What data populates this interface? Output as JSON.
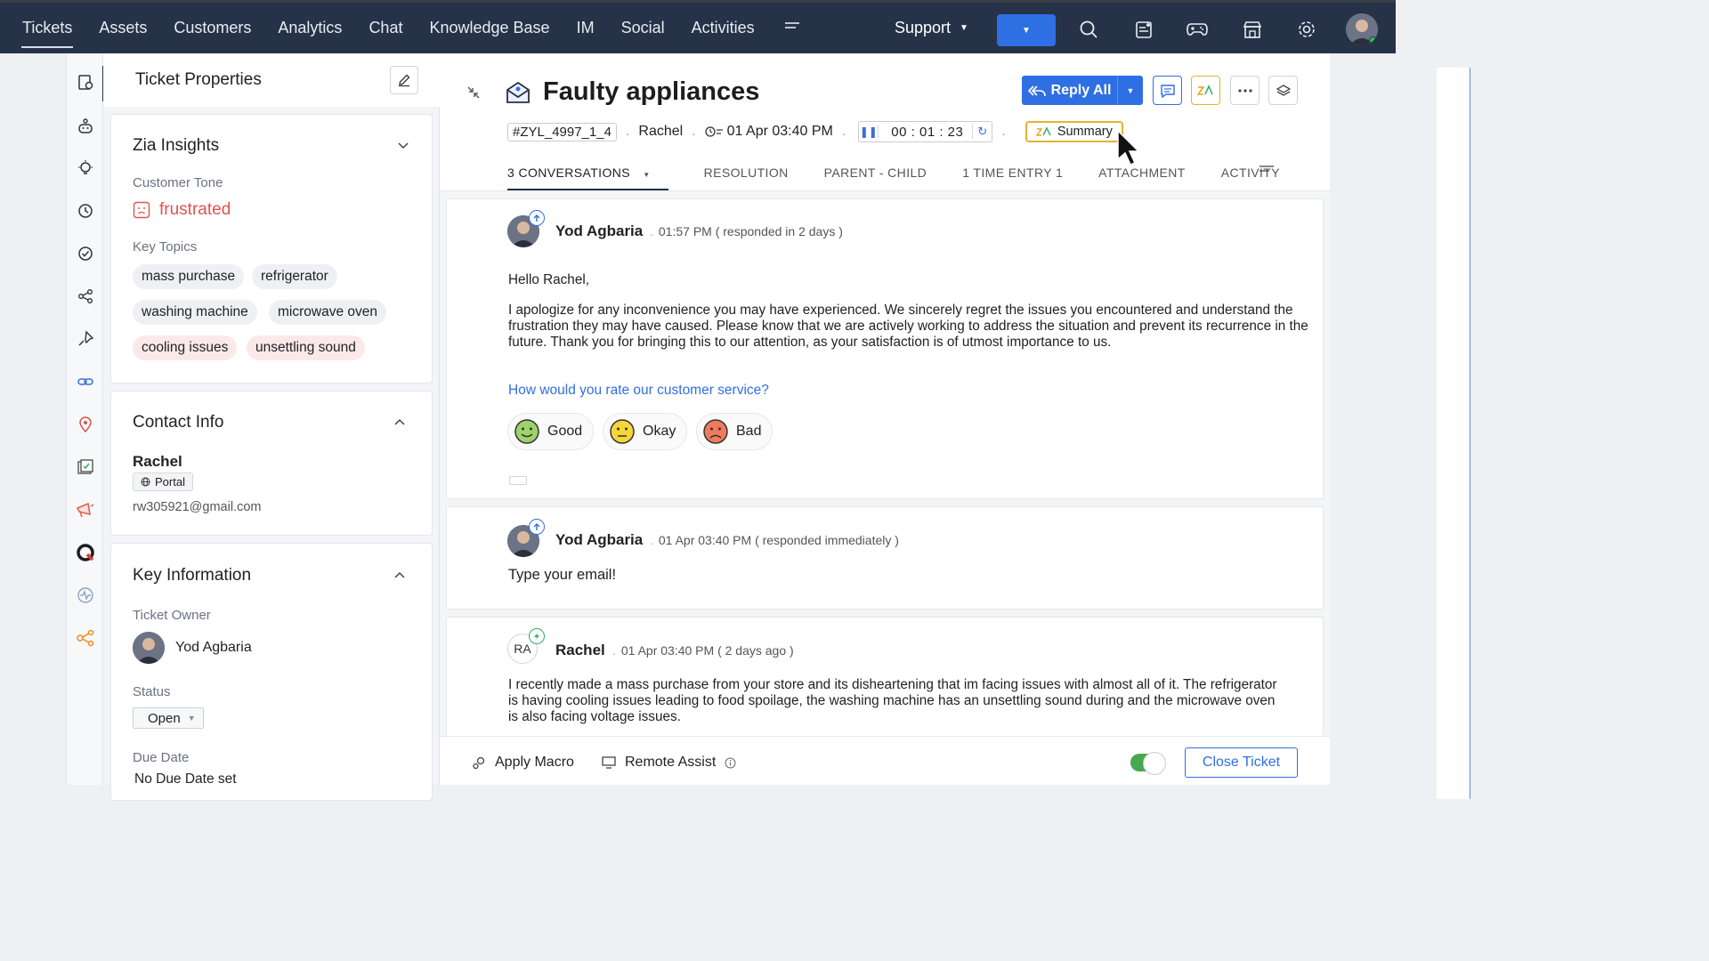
{
  "nav": {
    "items": [
      "Tickets",
      "Assets",
      "Customers",
      "Analytics",
      "Chat",
      "Knowledge Base",
      "IM",
      "Social",
      "Activities"
    ],
    "department": "Support"
  },
  "props": {
    "title": "Ticket Properties",
    "zia": {
      "title": "Zia Insights",
      "tone_label": "Customer Tone",
      "tone_value": "frustrated",
      "topics_label": "Key Topics",
      "topics": [
        "mass purchase",
        "refrigerator",
        "washing machine",
        "microwave oven",
        "cooling issues",
        "unsettling sound"
      ]
    },
    "contact": {
      "title": "Contact Info",
      "name": "Rachel",
      "channel": "Portal",
      "email": "rw305921@gmail.com"
    },
    "key": {
      "title": "Key Information",
      "owner_label": "Ticket Owner",
      "owner": "Yod Agbaria",
      "status_label": "Status",
      "status": "Open",
      "due_label": "Due Date",
      "due_value": "No Due Date set"
    }
  },
  "ticket": {
    "title": "Faulty appliances",
    "id": "#ZYL_4997_1_4",
    "contact": "Rachel",
    "created": "01 Apr 03:40 PM",
    "timer": "00 : 01 : 23",
    "summary_label": "Summary",
    "reply_all": "Reply All"
  },
  "tabs": [
    "3 CONVERSATIONS",
    "RESOLUTION",
    "PARENT - CHILD",
    "1 TIME ENTRY 1",
    "ATTACHMENT",
    "ACTIVITY"
  ],
  "conversations": [
    {
      "author": "Yod Agbaria",
      "time": "01:57 PM ( responded in 2 days )",
      "greeting": "Hello Rachel,",
      "body": "I apologize for any inconvenience you may have experienced. We sincerely regret the issues you encountered and understand the frustration they may have caused. Please know that we are actively working to address the situation and prevent its recurrence in the future. Thank you for bringing this to our attention, as your satisfaction is of utmost importance to us.",
      "rating_question": "How would you rate our customer service?",
      "ratings": [
        "Good",
        "Okay",
        "Bad"
      ]
    },
    {
      "author": "Yod Agbaria",
      "time": "01 Apr 03:40 PM ( responded immediately )",
      "body": "Type your email!"
    },
    {
      "author": "Rachel",
      "initials": "RA",
      "time": "01 Apr 03:40 PM ( 2 days ago )",
      "body": "I recently made a mass purchase from your store and its disheartening that im facing issues with almost all of it. The refrigerator is having cooling issues leading to food spoilage, the washing machine has an unsettling sound during and the microwave oven is also facing voltage issues."
    }
  ],
  "footer": {
    "apply_macro": "Apply Macro",
    "remote_assist": "Remote Assist",
    "close_ticket": "Close Ticket"
  },
  "colors": {
    "nav_bg": "#263247",
    "primary": "#2f6fe4",
    "tone_red": "#e05252",
    "summary_border": "#e5b233"
  }
}
